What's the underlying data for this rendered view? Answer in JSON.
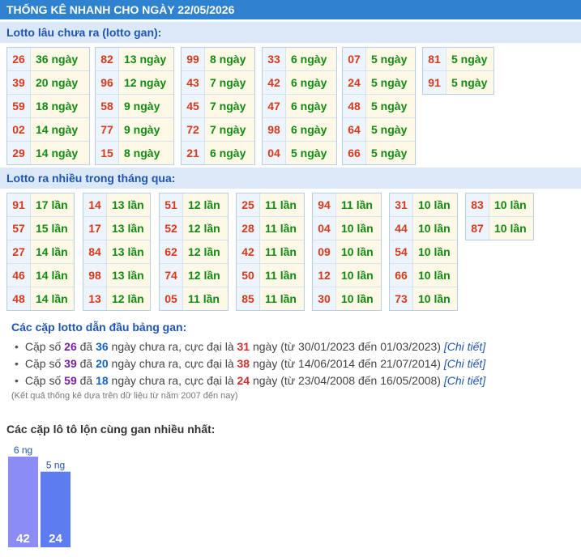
{
  "header": {
    "title": "THỐNG KÊ NHANH CHO NGÀY 22/05/2026"
  },
  "gan": {
    "title": "Lotto lâu chưa ra (lotto gan):",
    "blocks": [
      [
        [
          "26",
          "36 ngày"
        ],
        [
          "39",
          "20 ngày"
        ],
        [
          "59",
          "18 ngày"
        ],
        [
          "02",
          "14 ngày"
        ],
        [
          "29",
          "14 ngày"
        ]
      ],
      [
        [
          "82",
          "13 ngày"
        ],
        [
          "96",
          "12 ngày"
        ],
        [
          "58",
          "9 ngày"
        ],
        [
          "77",
          "9 ngày"
        ],
        [
          "15",
          "8 ngày"
        ]
      ],
      [
        [
          "99",
          "8 ngày"
        ],
        [
          "43",
          "7 ngày"
        ],
        [
          "45",
          "7 ngày"
        ],
        [
          "72",
          "7 ngày"
        ],
        [
          "21",
          "6 ngày"
        ]
      ],
      [
        [
          "33",
          "6 ngày"
        ],
        [
          "42",
          "6 ngày"
        ],
        [
          "47",
          "6 ngày"
        ],
        [
          "98",
          "6 ngày"
        ],
        [
          "04",
          "5 ngày"
        ]
      ],
      [
        [
          "07",
          "5 ngày"
        ],
        [
          "24",
          "5 ngày"
        ],
        [
          "48",
          "5 ngày"
        ],
        [
          "64",
          "5 ngày"
        ],
        [
          "66",
          "5 ngày"
        ]
      ],
      [
        [
          "81",
          "5 ngày"
        ],
        [
          "91",
          "5 ngày"
        ]
      ]
    ]
  },
  "frequent": {
    "title": "Lotto ra nhiều trong tháng qua:",
    "blocks": [
      [
        [
          "91",
          "17 lần"
        ],
        [
          "57",
          "15 lần"
        ],
        [
          "27",
          "14 lần"
        ],
        [
          "46",
          "14 lần"
        ],
        [
          "48",
          "14 lần"
        ]
      ],
      [
        [
          "14",
          "13 lần"
        ],
        [
          "17",
          "13 lần"
        ],
        [
          "84",
          "13 lần"
        ],
        [
          "98",
          "13 lần"
        ],
        [
          "13",
          "12 lần"
        ]
      ],
      [
        [
          "51",
          "12 lần"
        ],
        [
          "52",
          "12 lần"
        ],
        [
          "62",
          "12 lần"
        ],
        [
          "74",
          "12 lần"
        ],
        [
          "05",
          "11 lần"
        ]
      ],
      [
        [
          "25",
          "11 lần"
        ],
        [
          "28",
          "11 lần"
        ],
        [
          "42",
          "11 lần"
        ],
        [
          "50",
          "11 lần"
        ],
        [
          "85",
          "11 lần"
        ]
      ],
      [
        [
          "94",
          "11 lần"
        ],
        [
          "04",
          "10 lần"
        ],
        [
          "09",
          "10 lần"
        ],
        [
          "12",
          "10 lần"
        ],
        [
          "30",
          "10 lần"
        ]
      ],
      [
        [
          "31",
          "10 lần"
        ],
        [
          "44",
          "10 lần"
        ],
        [
          "54",
          "10 lần"
        ],
        [
          "66",
          "10 lần"
        ],
        [
          "73",
          "10 lần"
        ]
      ],
      [
        [
          "83",
          "10 lần"
        ],
        [
          "87",
          "10 lần"
        ]
      ]
    ]
  },
  "pairs": {
    "title": "Các cặp lotto dẫn đầu bảng gan:",
    "items": [
      {
        "prefix": "Cặp số ",
        "pair": "26",
        "mid1": " đã ",
        "days": "36",
        "mid2": " ngày chưa ra, cực đại là ",
        "max": "31",
        "mid3": " ngày (từ 30/01/2023 đến 01/03/2023) ",
        "link": "[Chi tiết]"
      },
      {
        "prefix": "Cặp số ",
        "pair": "39",
        "mid1": " đã ",
        "days": "20",
        "mid2": " ngày chưa ra, cực đại là ",
        "max": "38",
        "mid3": " ngày (từ 14/06/2014 đến 21/07/2014) ",
        "link": "[Chi tiết]"
      },
      {
        "prefix": "Cặp số ",
        "pair": "59",
        "mid1": " đã ",
        "days": "18",
        "mid2": " ngày chưa ra, cực đại là ",
        "max": "24",
        "mid3": " ngày (từ 23/04/2008 đến 16/05/2008) ",
        "link": "[Chi tiết]"
      }
    ],
    "note": "(Kết quả thống kê dựa trên dữ liệu từ năm 2007 đến nay)"
  },
  "chart_title": "Các cặp lô tô lộn cùng gan nhiều nhất:",
  "chart_data": {
    "type": "bar",
    "categories": [
      "42",
      "24"
    ],
    "values": [
      6,
      5
    ],
    "value_labels": [
      "6 ng",
      "5 ng"
    ],
    "colors": [
      "#8c8cf5",
      "#5c7cf0"
    ]
  }
}
